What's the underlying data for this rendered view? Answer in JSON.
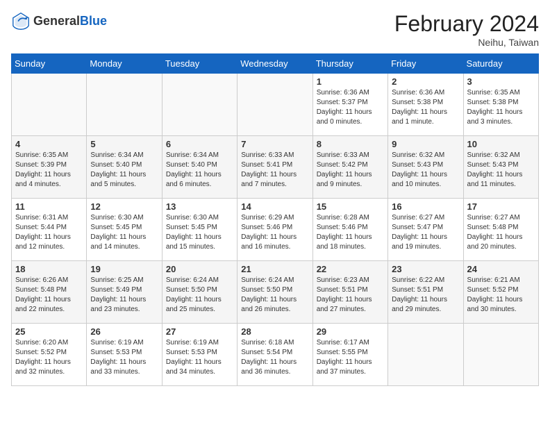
{
  "header": {
    "logo_general": "General",
    "logo_blue": "Blue",
    "month_title": "February 2024",
    "subtitle": "Neihu, Taiwan"
  },
  "days_of_week": [
    "Sunday",
    "Monday",
    "Tuesday",
    "Wednesday",
    "Thursday",
    "Friday",
    "Saturday"
  ],
  "weeks": [
    [
      {
        "day": "",
        "content": ""
      },
      {
        "day": "",
        "content": ""
      },
      {
        "day": "",
        "content": ""
      },
      {
        "day": "",
        "content": ""
      },
      {
        "day": "1",
        "content": "Sunrise: 6:36 AM\nSunset: 5:37 PM\nDaylight: 11 hours and 0 minutes."
      },
      {
        "day": "2",
        "content": "Sunrise: 6:36 AM\nSunset: 5:38 PM\nDaylight: 11 hours and 1 minute."
      },
      {
        "day": "3",
        "content": "Sunrise: 6:35 AM\nSunset: 5:38 PM\nDaylight: 11 hours and 3 minutes."
      }
    ],
    [
      {
        "day": "4",
        "content": "Sunrise: 6:35 AM\nSunset: 5:39 PM\nDaylight: 11 hours and 4 minutes."
      },
      {
        "day": "5",
        "content": "Sunrise: 6:34 AM\nSunset: 5:40 PM\nDaylight: 11 hours and 5 minutes."
      },
      {
        "day": "6",
        "content": "Sunrise: 6:34 AM\nSunset: 5:40 PM\nDaylight: 11 hours and 6 minutes."
      },
      {
        "day": "7",
        "content": "Sunrise: 6:33 AM\nSunset: 5:41 PM\nDaylight: 11 hours and 7 minutes."
      },
      {
        "day": "8",
        "content": "Sunrise: 6:33 AM\nSunset: 5:42 PM\nDaylight: 11 hours and 9 minutes."
      },
      {
        "day": "9",
        "content": "Sunrise: 6:32 AM\nSunset: 5:43 PM\nDaylight: 11 hours and 10 minutes."
      },
      {
        "day": "10",
        "content": "Sunrise: 6:32 AM\nSunset: 5:43 PM\nDaylight: 11 hours and 11 minutes."
      }
    ],
    [
      {
        "day": "11",
        "content": "Sunrise: 6:31 AM\nSunset: 5:44 PM\nDaylight: 11 hours and 12 minutes."
      },
      {
        "day": "12",
        "content": "Sunrise: 6:30 AM\nSunset: 5:45 PM\nDaylight: 11 hours and 14 minutes."
      },
      {
        "day": "13",
        "content": "Sunrise: 6:30 AM\nSunset: 5:45 PM\nDaylight: 11 hours and 15 minutes."
      },
      {
        "day": "14",
        "content": "Sunrise: 6:29 AM\nSunset: 5:46 PM\nDaylight: 11 hours and 16 minutes."
      },
      {
        "day": "15",
        "content": "Sunrise: 6:28 AM\nSunset: 5:46 PM\nDaylight: 11 hours and 18 minutes."
      },
      {
        "day": "16",
        "content": "Sunrise: 6:27 AM\nSunset: 5:47 PM\nDaylight: 11 hours and 19 minutes."
      },
      {
        "day": "17",
        "content": "Sunrise: 6:27 AM\nSunset: 5:48 PM\nDaylight: 11 hours and 20 minutes."
      }
    ],
    [
      {
        "day": "18",
        "content": "Sunrise: 6:26 AM\nSunset: 5:48 PM\nDaylight: 11 hours and 22 minutes."
      },
      {
        "day": "19",
        "content": "Sunrise: 6:25 AM\nSunset: 5:49 PM\nDaylight: 11 hours and 23 minutes."
      },
      {
        "day": "20",
        "content": "Sunrise: 6:24 AM\nSunset: 5:50 PM\nDaylight: 11 hours and 25 minutes."
      },
      {
        "day": "21",
        "content": "Sunrise: 6:24 AM\nSunset: 5:50 PM\nDaylight: 11 hours and 26 minutes."
      },
      {
        "day": "22",
        "content": "Sunrise: 6:23 AM\nSunset: 5:51 PM\nDaylight: 11 hours and 27 minutes."
      },
      {
        "day": "23",
        "content": "Sunrise: 6:22 AM\nSunset: 5:51 PM\nDaylight: 11 hours and 29 minutes."
      },
      {
        "day": "24",
        "content": "Sunrise: 6:21 AM\nSunset: 5:52 PM\nDaylight: 11 hours and 30 minutes."
      }
    ],
    [
      {
        "day": "25",
        "content": "Sunrise: 6:20 AM\nSunset: 5:52 PM\nDaylight: 11 hours and 32 minutes."
      },
      {
        "day": "26",
        "content": "Sunrise: 6:19 AM\nSunset: 5:53 PM\nDaylight: 11 hours and 33 minutes."
      },
      {
        "day": "27",
        "content": "Sunrise: 6:19 AM\nSunset: 5:53 PM\nDaylight: 11 hours and 34 minutes."
      },
      {
        "day": "28",
        "content": "Sunrise: 6:18 AM\nSunset: 5:54 PM\nDaylight: 11 hours and 36 minutes."
      },
      {
        "day": "29",
        "content": "Sunrise: 6:17 AM\nSunset: 5:55 PM\nDaylight: 11 hours and 37 minutes."
      },
      {
        "day": "",
        "content": ""
      },
      {
        "day": "",
        "content": ""
      }
    ]
  ]
}
